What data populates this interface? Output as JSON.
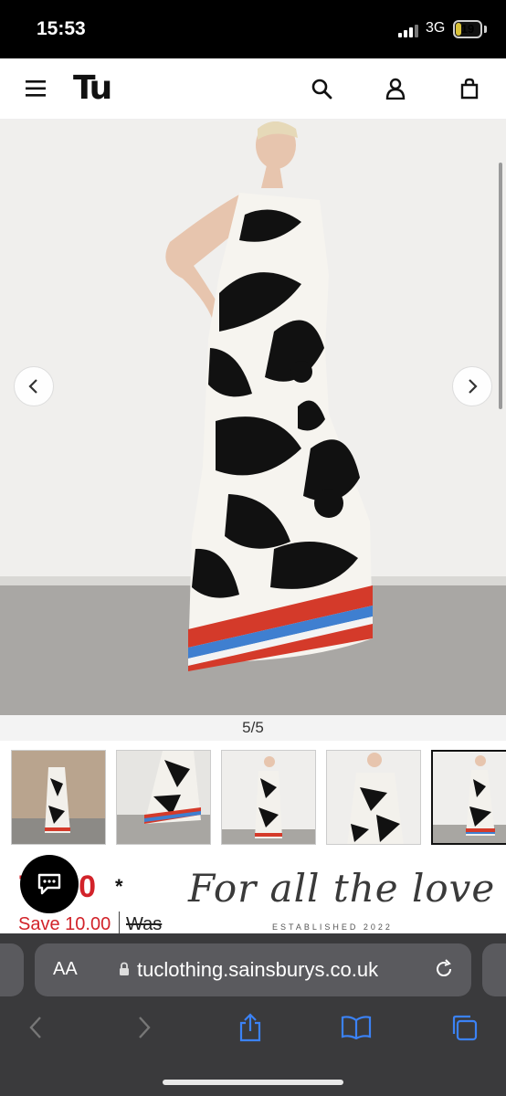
{
  "status_bar": {
    "time": "15:53",
    "network": "3G",
    "battery": "19",
    "battery_level": 0.19
  },
  "header": {
    "logo": "Tu"
  },
  "gallery": {
    "counter": "5/5",
    "thumb_count": 5,
    "active_thumb": 5
  },
  "price": {
    "amount": "70.00",
    "asterisk": "*",
    "save": "Save 10.00",
    "was": "Was"
  },
  "promo": {
    "script": "For all the love",
    "established": "ESTABLISHED 2022"
  },
  "browser": {
    "aa": "AA",
    "url": "tuclothing.sainsburys.co.uk"
  },
  "colors": {
    "price_red": "#d2232a",
    "toolbar_blue": "#3b82f6",
    "status_black": "#000000",
    "battery_yellow": "#d9c23a"
  }
}
